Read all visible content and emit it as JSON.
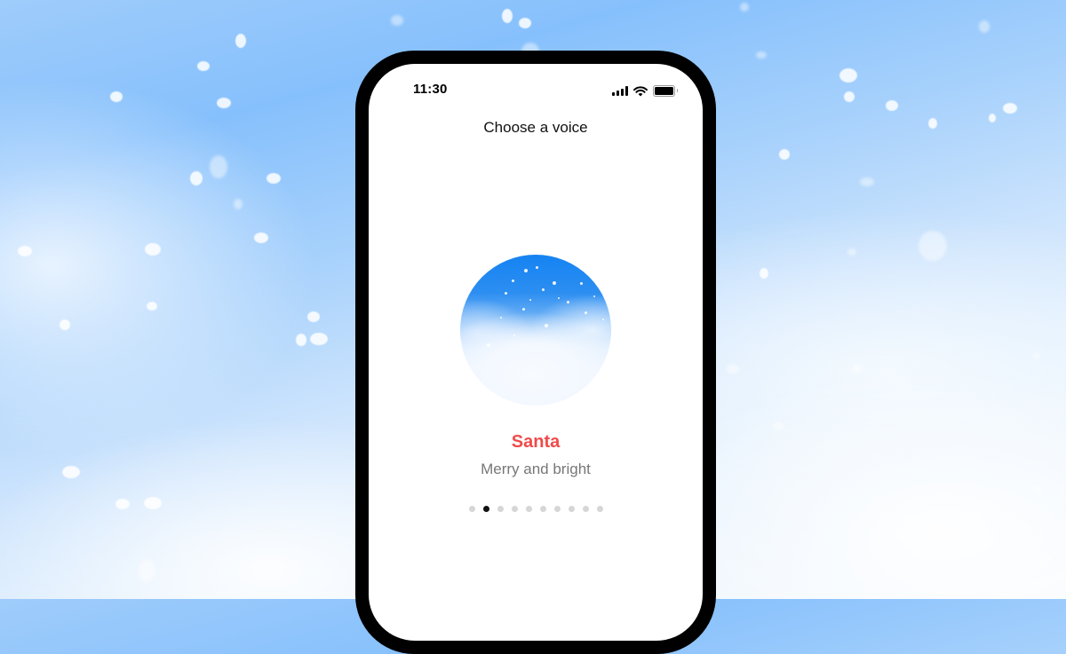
{
  "status_bar": {
    "time": "11:30",
    "icons": [
      "cellular-signal-icon",
      "wifi-icon",
      "battery-icon"
    ]
  },
  "header": {
    "title": "Choose a voice"
  },
  "voice": {
    "name": "Santa",
    "description": "Merry and bright",
    "name_color": "#f04a4a"
  },
  "pager": {
    "total": 10,
    "active_index": 1
  },
  "theme": {
    "sky_top": "#86c0fc",
    "sky_bottom": "#f8fbff",
    "orb_blue": "#1583f2"
  }
}
